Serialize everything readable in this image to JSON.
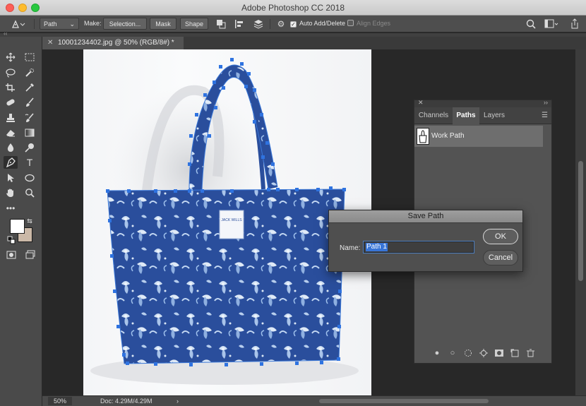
{
  "window": {
    "title": "Adobe Photoshop CC 2018"
  },
  "options_bar": {
    "mode_value": "Path",
    "make_label": "Make:",
    "selection_btn": "Selection...",
    "mask_btn": "Mask",
    "shape_btn": "Shape",
    "auto_add_delete": {
      "label": "Auto Add/Delete",
      "checked": true
    },
    "align_edges": {
      "label": "Align Edges",
      "checked": false
    }
  },
  "document": {
    "tab_title": "10001234402.jpg @ 50% (RGB/8#) *",
    "bag_label": "JACK WILLS"
  },
  "tools": [
    "move-tool",
    "marquee-tool",
    "lasso-tool",
    "quick-selection-tool",
    "crop-tool",
    "eyedropper-tool",
    "healing-brush-tool",
    "brush-tool",
    "clone-stamp-tool",
    "history-brush-tool",
    "eraser-tool",
    "gradient-tool",
    "blur-tool",
    "dodge-tool",
    "pen-tool",
    "type-tool",
    "path-selection-tool",
    "ellipse-tool",
    "hand-tool",
    "zoom-tool",
    "more-tools",
    "foreground-color",
    "background-color",
    "quick-mask",
    "screen-mode"
  ],
  "colors": {
    "foreground": "#ffffff",
    "background": "#cbb9a8",
    "accent": "#3875d7"
  },
  "panel": {
    "tabs": [
      "Channels",
      "Paths",
      "Layers"
    ],
    "active_tab": "Paths",
    "paths": [
      {
        "name": "Work Path"
      }
    ]
  },
  "dialog": {
    "title": "Save Path",
    "name_label": "Name:",
    "name_value": "Path 1",
    "ok": "OK",
    "cancel": "Cancel"
  },
  "status": {
    "zoom": "50%",
    "doc_size": "Doc: 4.29M/4.29M",
    "arrow": "›"
  }
}
